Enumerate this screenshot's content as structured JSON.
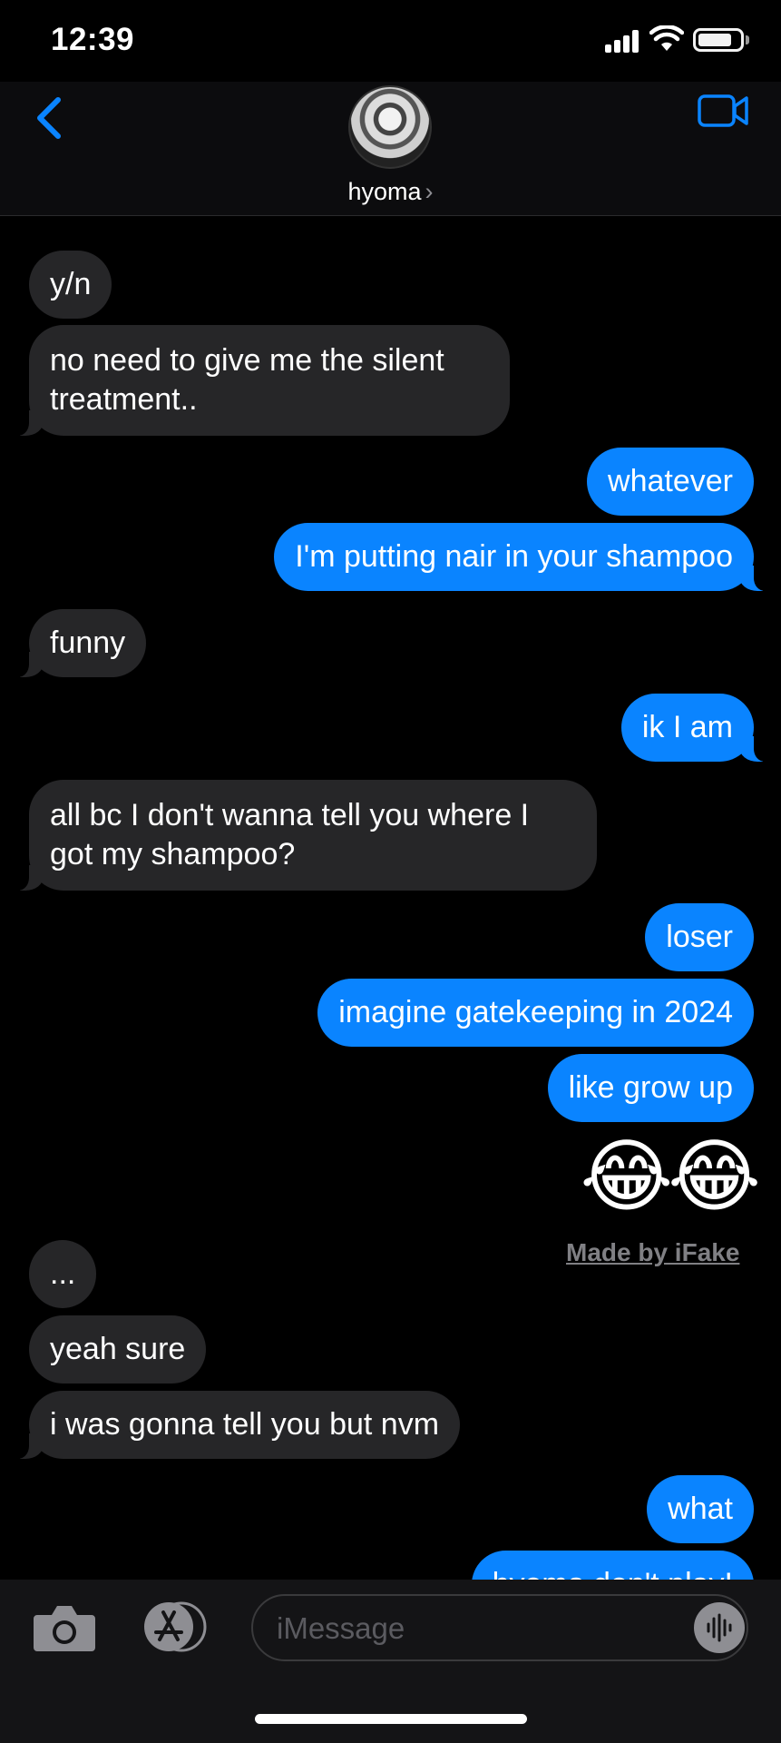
{
  "status_bar": {
    "time": "12:39"
  },
  "header": {
    "contact_name": "hyoma",
    "chevron": "›"
  },
  "messages": [
    {
      "dir": "in",
      "text": "y/n"
    },
    {
      "dir": "in",
      "text": "no need to give me the silent\ntreatment.."
    },
    {
      "dir": "out",
      "text": "whatever"
    },
    {
      "dir": "out",
      "text": "I'm putting nair in your shampoo"
    },
    {
      "dir": "in",
      "text": "funny"
    },
    {
      "dir": "out",
      "text": "ik I am"
    },
    {
      "dir": "in",
      "text": "all bc I don't wanna tell you where I\ngot my shampoo?"
    },
    {
      "dir": "out",
      "text": "loser"
    },
    {
      "dir": "out",
      "text": "imagine gatekeeping in 2024"
    },
    {
      "dir": "out",
      "text": "like grow up"
    },
    {
      "dir": "out",
      "text": "😂😂"
    },
    {
      "dir": "in",
      "text": "..."
    },
    {
      "dir": "in",
      "text": "yeah sure"
    },
    {
      "dir": "in",
      "text": "i was gonna tell you but nvm"
    },
    {
      "dir": "out",
      "text": "what"
    },
    {
      "dir": "out",
      "text": "hyoma don't play!"
    }
  ],
  "watermark": "Made by iFake",
  "input": {
    "placeholder": "iMessage"
  },
  "colors": {
    "outgoing": "#0a84ff",
    "incoming": "#262628",
    "accent": "#0a84ff"
  },
  "icons": [
    "back-chevron-icon",
    "video-camera-icon",
    "camera-icon",
    "app-store-icon",
    "audio-waveform-icon"
  ]
}
